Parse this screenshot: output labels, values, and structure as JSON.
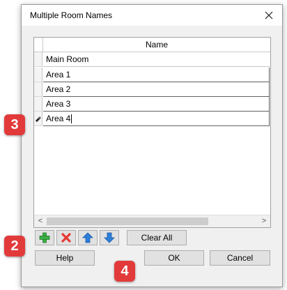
{
  "window": {
    "title": "Multiple Room Names"
  },
  "grid": {
    "column_header": "Name",
    "rows": [
      "Main Room",
      "Area 1",
      "Area 2",
      "Area 3",
      "Area 4"
    ],
    "editing_row_index": 4
  },
  "scrollbar": {
    "left_arrow": "<",
    "right_arrow": ">"
  },
  "toolbar": {
    "add_icon": "green-plus-icon",
    "delete_icon": "red-x-icon",
    "move_up_icon": "blue-up-arrow-icon",
    "move_down_icon": "blue-down-arrow-icon",
    "clear_all_label": "Clear All"
  },
  "buttons": {
    "help": "Help",
    "ok": "OK",
    "cancel": "Cancel"
  },
  "callouts": {
    "badge_3": "3",
    "badge_2": "2",
    "badge_4": "4"
  },
  "colors": {
    "badge": "#e23a3a",
    "add": "#3cb043",
    "delete": "#e53935",
    "arrows": "#2d7fd8"
  }
}
